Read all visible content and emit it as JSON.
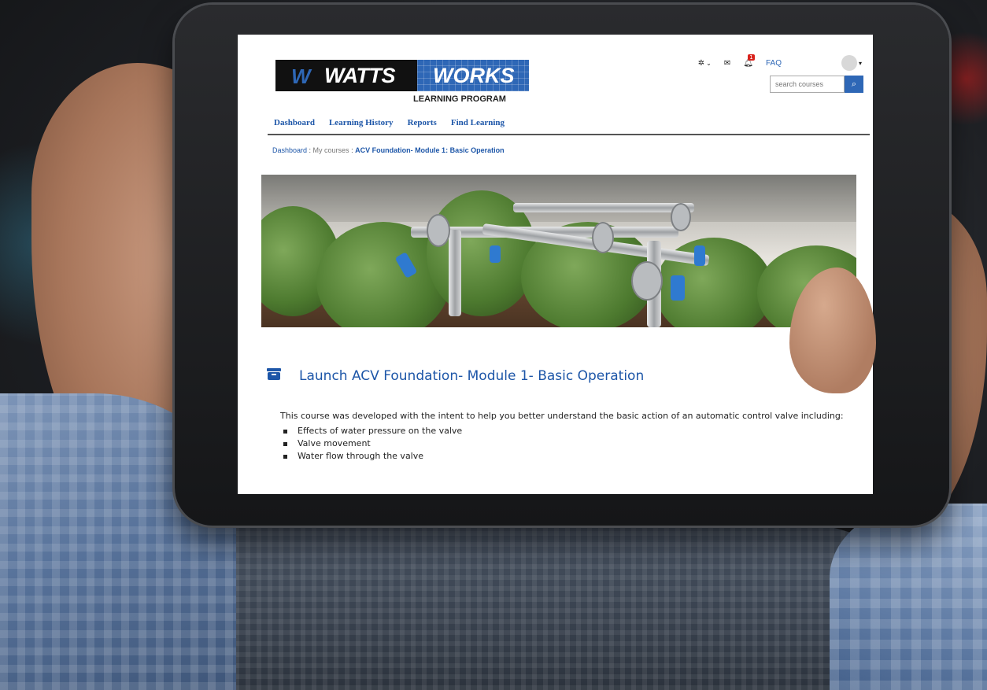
{
  "logo": {
    "mark": "W",
    "brand_watts": "WATTS",
    "brand_works": "WORKS",
    "subtitle": "LEARNING PROGRAM"
  },
  "topbar": {
    "settings_icon": "gear-icon",
    "messages_icon": "envelope-icon",
    "notifications_icon": "bell-icon",
    "notification_count": "1",
    "faq_label": "FAQ",
    "user_icon": "avatar"
  },
  "search": {
    "placeholder": "search courses",
    "button_icon": "search-icon"
  },
  "nav": {
    "items": [
      {
        "label": "Dashboard"
      },
      {
        "label": "Learning History"
      },
      {
        "label": "Reports"
      },
      {
        "label": "Find Learning"
      }
    ]
  },
  "breadcrumb": {
    "root": "Dashboard",
    "sep1": " : ",
    "mid": "My courses",
    "sep2": " : ",
    "current": "ACV Foundation- Module 1: Basic Operation"
  },
  "course": {
    "launch_title": "Launch ACV Foundation- Module 1- Basic Operation",
    "description": "This course was developed with the intent to help you better understand the basic action of an automatic control valve including:",
    "bullets": [
      "Effects of water pressure on the valve",
      "Valve movement",
      "Water flow through the valve"
    ]
  },
  "colors": {
    "brand_blue": "#2e67b6",
    "link_blue": "#1d56a8",
    "badge_red": "#d9231d"
  }
}
